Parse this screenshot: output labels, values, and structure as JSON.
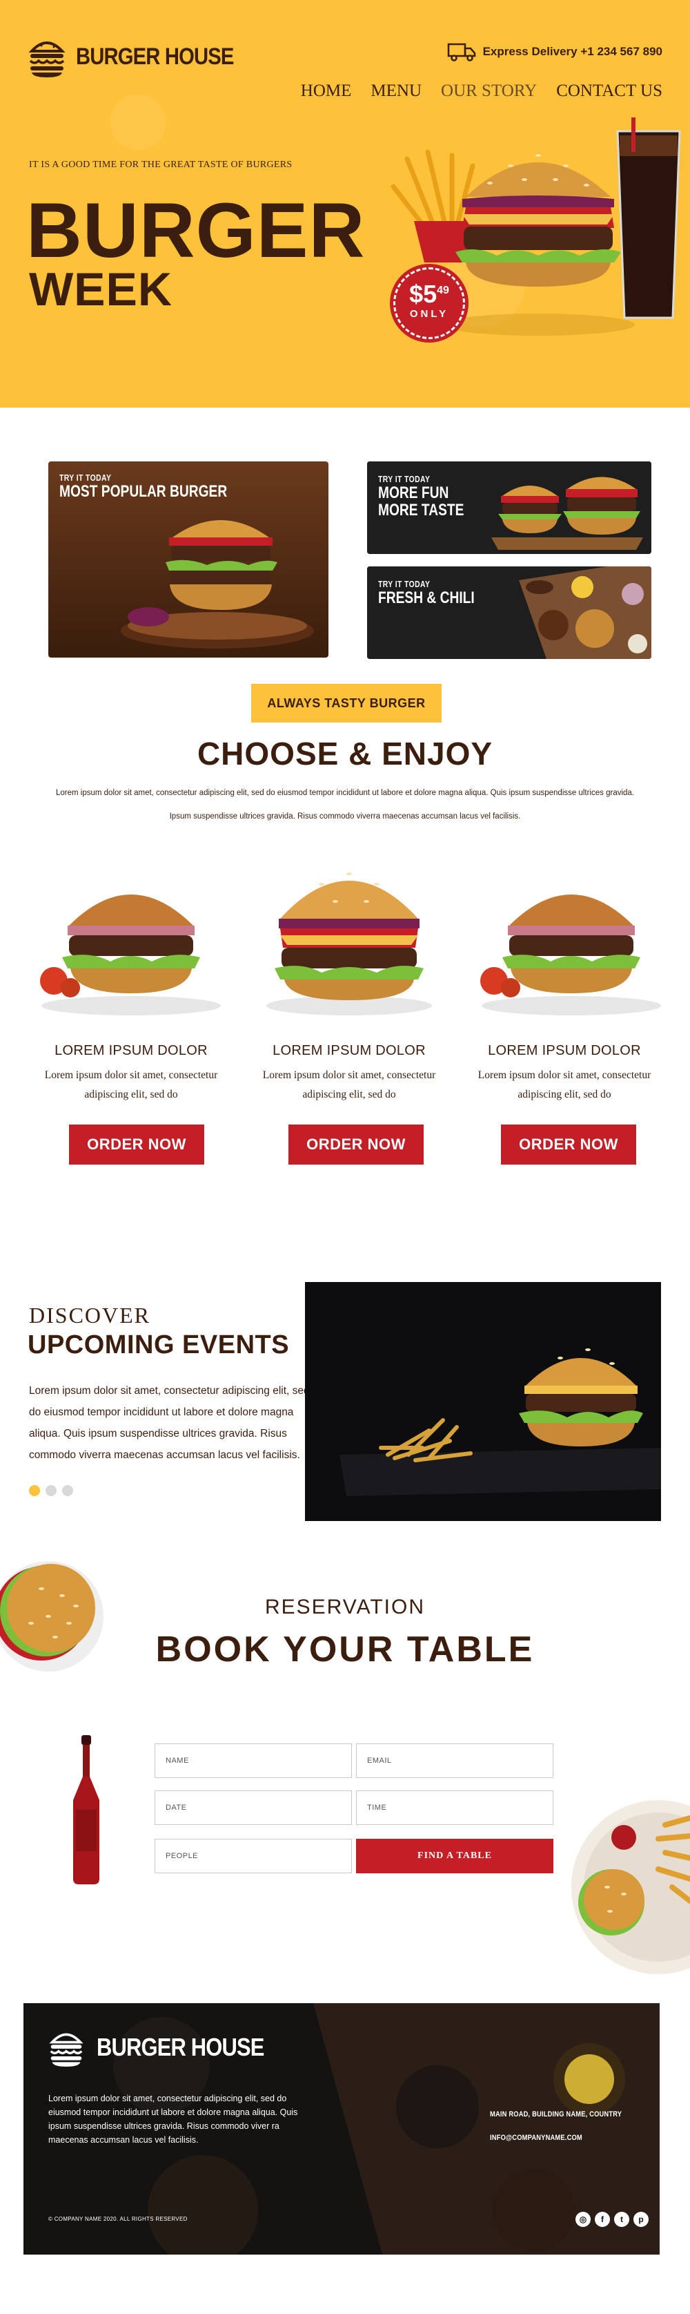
{
  "brand": {
    "name": "BURGER HOUSE"
  },
  "header": {
    "delivery": "Express Delivery +1 234 567 890",
    "nav": [
      "HOME",
      "MENU",
      "OUR STORY",
      "CONTACT US"
    ]
  },
  "hero": {
    "tagline": "IT IS A GOOD TIME FOR THE GREAT TASTE OF BURGERS",
    "title": "BURGER",
    "subtitle": "WEEK",
    "price_main": "$5",
    "price_cents": "49",
    "price_only": "ONLY"
  },
  "promos": [
    {
      "kicker": "TRY IT TODAY",
      "headline": "MOST POPULAR BURGER"
    },
    {
      "kicker": "TRY IT TODAY",
      "headline_1": "MORE FUN",
      "headline_2": "MORE TASTE"
    },
    {
      "kicker": "TRY IT TODAY",
      "headline": "FRESH & CHILI"
    }
  ],
  "choose": {
    "badge": "ALWAYS TASTY BURGER",
    "title": "CHOOSE & ENJOY",
    "lead_1": "Lorem ipsum dolor sit amet, consectetur adipiscing elit, sed do eiusmod tempor incididunt ut labore et dolore magna aliqua. Quis ipsum suspendisse ultrices gravida.",
    "lead_2": "Ipsum suspendisse ultrices gravida. Risus commodo viverra maecenas accumsan lacus vel facilisis."
  },
  "products": [
    {
      "name": "LOREM IPSUM DOLOR",
      "desc": "Lorem ipsum dolor sit amet, consectetur adipiscing elit, sed do",
      "button": "ORDER NOW"
    },
    {
      "name": "LOREM IPSUM DOLOR",
      "desc": "Lorem ipsum dolor sit amet, consectetur adipiscing elit, sed do",
      "button": "ORDER NOW"
    },
    {
      "name": "LOREM IPSUM DOLOR",
      "desc": "Lorem ipsum dolor sit amet, consectetur adipiscing elit, sed do",
      "button": "ORDER NOW"
    }
  ],
  "events": {
    "kicker": "DISCOVER",
    "title": "UPCOMING EVENTS",
    "text": "Lorem ipsum dolor sit amet, consectetur adipiscing elit, sed do eiusmod tempor incididunt ut labore et dolore magna aliqua. Quis ipsum suspendisse ultrices gravida. Risus commodo viverra maecenas accumsan lacus vel facilisis.",
    "active_slide": 1,
    "slide_count": 3
  },
  "reservation": {
    "kicker": "RESERVATION",
    "title": "BOOK YOUR TABLE",
    "fields": {
      "name": "NAME",
      "email": "EMAIL",
      "date": "DATE",
      "time": "TIME",
      "people": "PEOPLE"
    },
    "button": "FIND A TABLE"
  },
  "footer": {
    "brand": "BURGER HOUSE",
    "text": "Lorem ipsum dolor sit amet, consectetur adipiscing elit, sed do eiusmod tempor incididunt ut labore et dolore magna aliqua. Quis ipsum suspendisse ultrices gravida. Risus commodo viver ra maecenas accumsan lacus vel facilisis.",
    "address": "MAIN ROAD, BUILDING NAME, COUNTRY",
    "email": "INFO@COMPANYNAME.COM",
    "copyright": "© COMPANY NAME 2020. ALL RIGHTS RESERVED",
    "socials": [
      "instagram-icon",
      "facebook-icon",
      "twitter-icon",
      "pinterest-icon"
    ]
  },
  "colors": {
    "brand_yellow": "#fdc13a",
    "brand_red": "#c41e26",
    "brand_brown": "#3b1e0e",
    "footer_dark": "#141414"
  }
}
